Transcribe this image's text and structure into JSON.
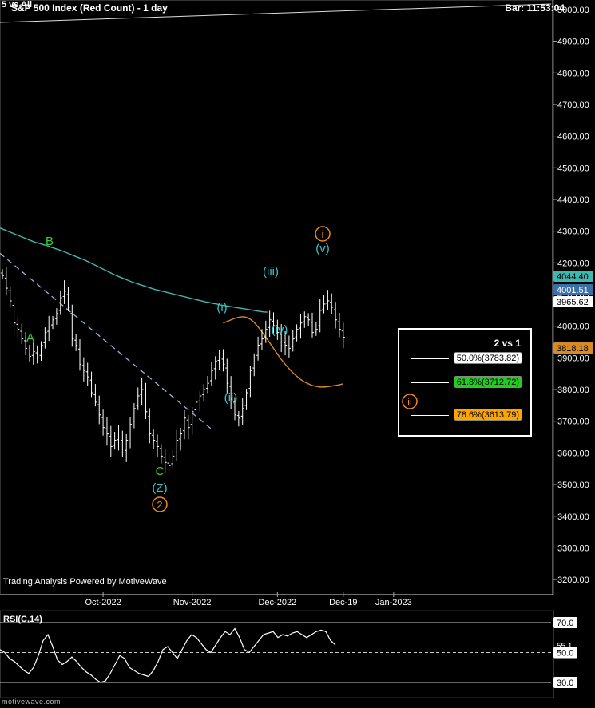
{
  "chart": {
    "title": "S&P 500 Index (Red Count) - 1 day",
    "top_left": "5 vs All",
    "bar_info": "Bar: 11:53:04",
    "powered_by": "Trading Analysis Powered by MotiveWave",
    "watermark": "motivewave.com"
  },
  "colors": {
    "background": "#000000",
    "price_bars": "#ffffff",
    "sma_teal": "#3fb8b0",
    "sma_orange": "#d68a2a",
    "trend_dashed": "#8fb8d8",
    "wave_green": "#2fd62f",
    "wave_teal": "#3cc3c8",
    "wave_orange": "#f08a1c",
    "fib_50": "#ffffff",
    "fib_618": "#22cc22",
    "fib_786": "#ffa500"
  },
  "chart_data": {
    "type": "ohlc",
    "timeframe": "1 day",
    "y_axis": {
      "ticks": [
        "5000.00",
        "4900.00",
        "4800.00",
        "4700.00",
        "4600.00",
        "4500.00",
        "4400.00",
        "4300.00",
        "4200.00",
        "4100.00",
        "4000.00",
        "3900.00",
        "3800.00",
        "3700.00",
        "3600.00",
        "3500.00",
        "3400.00",
        "3300.00",
        "3200.00"
      ],
      "ylim": [
        3160,
        5030
      ]
    },
    "x_axis": {
      "ticks": [
        "Oct-2022",
        "Nov-2022",
        "Dec-2022",
        "Dec-19",
        "Jan-2023"
      ],
      "tick_bar_index": [
        26,
        49,
        71,
        88,
        101
      ]
    },
    "ohlc_closes": [
      4160,
      4120,
      4080,
      4010,
      3990,
      3960,
      3930,
      3905,
      3920,
      3900,
      3940,
      3980,
      4000,
      4020,
      4040,
      4090,
      4110,
      4060,
      3960,
      3940,
      3880,
      3860,
      3840,
      3790,
      3760,
      3720,
      3680,
      3660,
      3620,
      3640,
      3650,
      3600,
      3640,
      3690,
      3740,
      3780,
      3800,
      3730,
      3660,
      3640,
      3620,
      3590,
      3570,
      3560,
      3590,
      3640,
      3660,
      3710,
      3680,
      3730,
      3760,
      3780,
      3800,
      3820,
      3860,
      3890,
      3900,
      3880,
      3820,
      3770,
      3720,
      3710,
      3740,
      3790,
      3860,
      3900,
      3940,
      3960,
      3990,
      4020,
      4000,
      3980,
      3950,
      3940,
      3930,
      3960,
      3990,
      4010,
      4030,
      4020,
      3980,
      3990,
      4050,
      4070,
      4080,
      4060,
      4020,
      3990,
      3965
    ],
    "bars_shown": 89,
    "series": [
      {
        "name": "",
        "type": "sma",
        "color": "#3fb8b0",
        "values": [
          4310,
          4305,
          4300,
          4295,
          4290,
          4285,
          4280,
          4275,
          4270,
          4265,
          4262,
          4258,
          4255,
          4250,
          4246,
          4242,
          4238,
          4233,
          4228,
          4223,
          4218,
          4213,
          4208,
          4202,
          4196,
          4190,
          4184,
          4178,
          4172,
          4166,
          4160,
          4155,
          4150,
          4145,
          4140,
          4136,
          4132,
          4128,
          4124,
          4120,
          4116,
          4113,
          4110,
          4107,
          4104,
          4101,
          4098,
          4095,
          4092,
          4089,
          4086,
          4083,
          4080,
          4077,
          4075,
          4072,
          4070,
          4067,
          4065,
          4063,
          4061,
          4059,
          4057,
          4055,
          4053,
          4051,
          4049,
          4047,
          4045,
          4044.4
        ]
      },
      {
        "name": "",
        "type": "sma",
        "color": "#d68a2a",
        "values": [
          4010,
          4015,
          4020,
          4025,
          4028,
          4030,
          4028,
          4022,
          4012,
          3998,
          3982,
          3965,
          3948,
          3930,
          3912,
          3895,
          3880,
          3866,
          3853,
          3842,
          3832,
          3824,
          3818,
          3813,
          3810,
          3808,
          3808,
          3809,
          3811,
          3813,
          3815,
          3818.18
        ]
      }
    ],
    "current_price": "3965.62",
    "price_tags": [
      {
        "value": "4044.40",
        "color": "#3fb8b0"
      },
      {
        "value": "4001.51",
        "color": "#3a6fa8"
      },
      {
        "value": "3965.62",
        "color": "#ffffff"
      },
      {
        "value": "3818.18",
        "color": "#d68a2a"
      }
    ],
    "wave_labels": [
      {
        "text": "A",
        "price": 3880,
        "bar": 3,
        "color": "#2fd62f",
        "style": "plain"
      },
      {
        "text": "B",
        "price": 4155,
        "bar": 5,
        "color": "#2fd62f",
        "style": "plain"
      },
      {
        "text": "C",
        "price": 3475,
        "bar": 24,
        "color": "#2fd62f",
        "style": "plain"
      },
      {
        "text": "(Z)",
        "price": 3425,
        "bar": 24,
        "color": "#3cc3c8",
        "style": "plain"
      },
      {
        "text": "2",
        "price": 3375,
        "bar": 24,
        "color": "#f08a1c",
        "style": "circle"
      },
      {
        "text": "(i)",
        "price": 3935,
        "bar": 33,
        "color": "#3cc3c8",
        "style": "plain"
      },
      {
        "text": "(ii)",
        "price": 3675,
        "bar": 34,
        "color": "#3cc3c8",
        "style": "plain"
      },
      {
        "text": "(iii)",
        "price": 4050,
        "bar": 40,
        "color": "#3cc3c8",
        "style": "plain"
      },
      {
        "text": "(iv)",
        "price": 3885,
        "bar": 41,
        "color": "#3cc3c8",
        "style": "plain"
      },
      {
        "text": "(v)",
        "price": 4130,
        "bar": 47,
        "color": "#3cc3c8",
        "style": "plain"
      },
      {
        "text": "i",
        "price": 4185,
        "bar": 47,
        "color": "#f08a1c",
        "style": "circle"
      },
      {
        "text": "ii",
        "price": 3635,
        "bar": 60,
        "color": "#f08a1c",
        "style": "circle"
      }
    ],
    "fib_box": {
      "header": "2 vs 1",
      "levels": [
        {
          "label": "50.0%(3783.82)",
          "ratio": 0.5,
          "price": 3783.82,
          "color": "#ffffff"
        },
        {
          "label": "61.8%(3712.72)",
          "ratio": 0.618,
          "price": 3712.72,
          "color": "#22cc22"
        },
        {
          "label": "78.6%(3613.79)",
          "ratio": 0.786,
          "price": 3613.79,
          "color": "#ffa500"
        }
      ]
    }
  },
  "rsi": {
    "title": "RSI(C,14)",
    "levels": [
      "70.0",
      "30.0"
    ],
    "current": "55.1",
    "mid": "50.0",
    "values": [
      52,
      50,
      46,
      44,
      41,
      38,
      36,
      40,
      48,
      58,
      62,
      54,
      45,
      42,
      44,
      47,
      44,
      40,
      37,
      35,
      32,
      30,
      31,
      36,
      42,
      48,
      46,
      40,
      38,
      36,
      35,
      34,
      38,
      44,
      52,
      54,
      50,
      46,
      52,
      58,
      62,
      60,
      56,
      52,
      50,
      55,
      60,
      64,
      62,
      66,
      60,
      52,
      50,
      54,
      58,
      62,
      63,
      64,
      60,
      62,
      61,
      63,
      64,
      62,
      60,
      62,
      64,
      65,
      64,
      58,
      55.1
    ],
    "ylim": [
      22,
      78
    ]
  }
}
